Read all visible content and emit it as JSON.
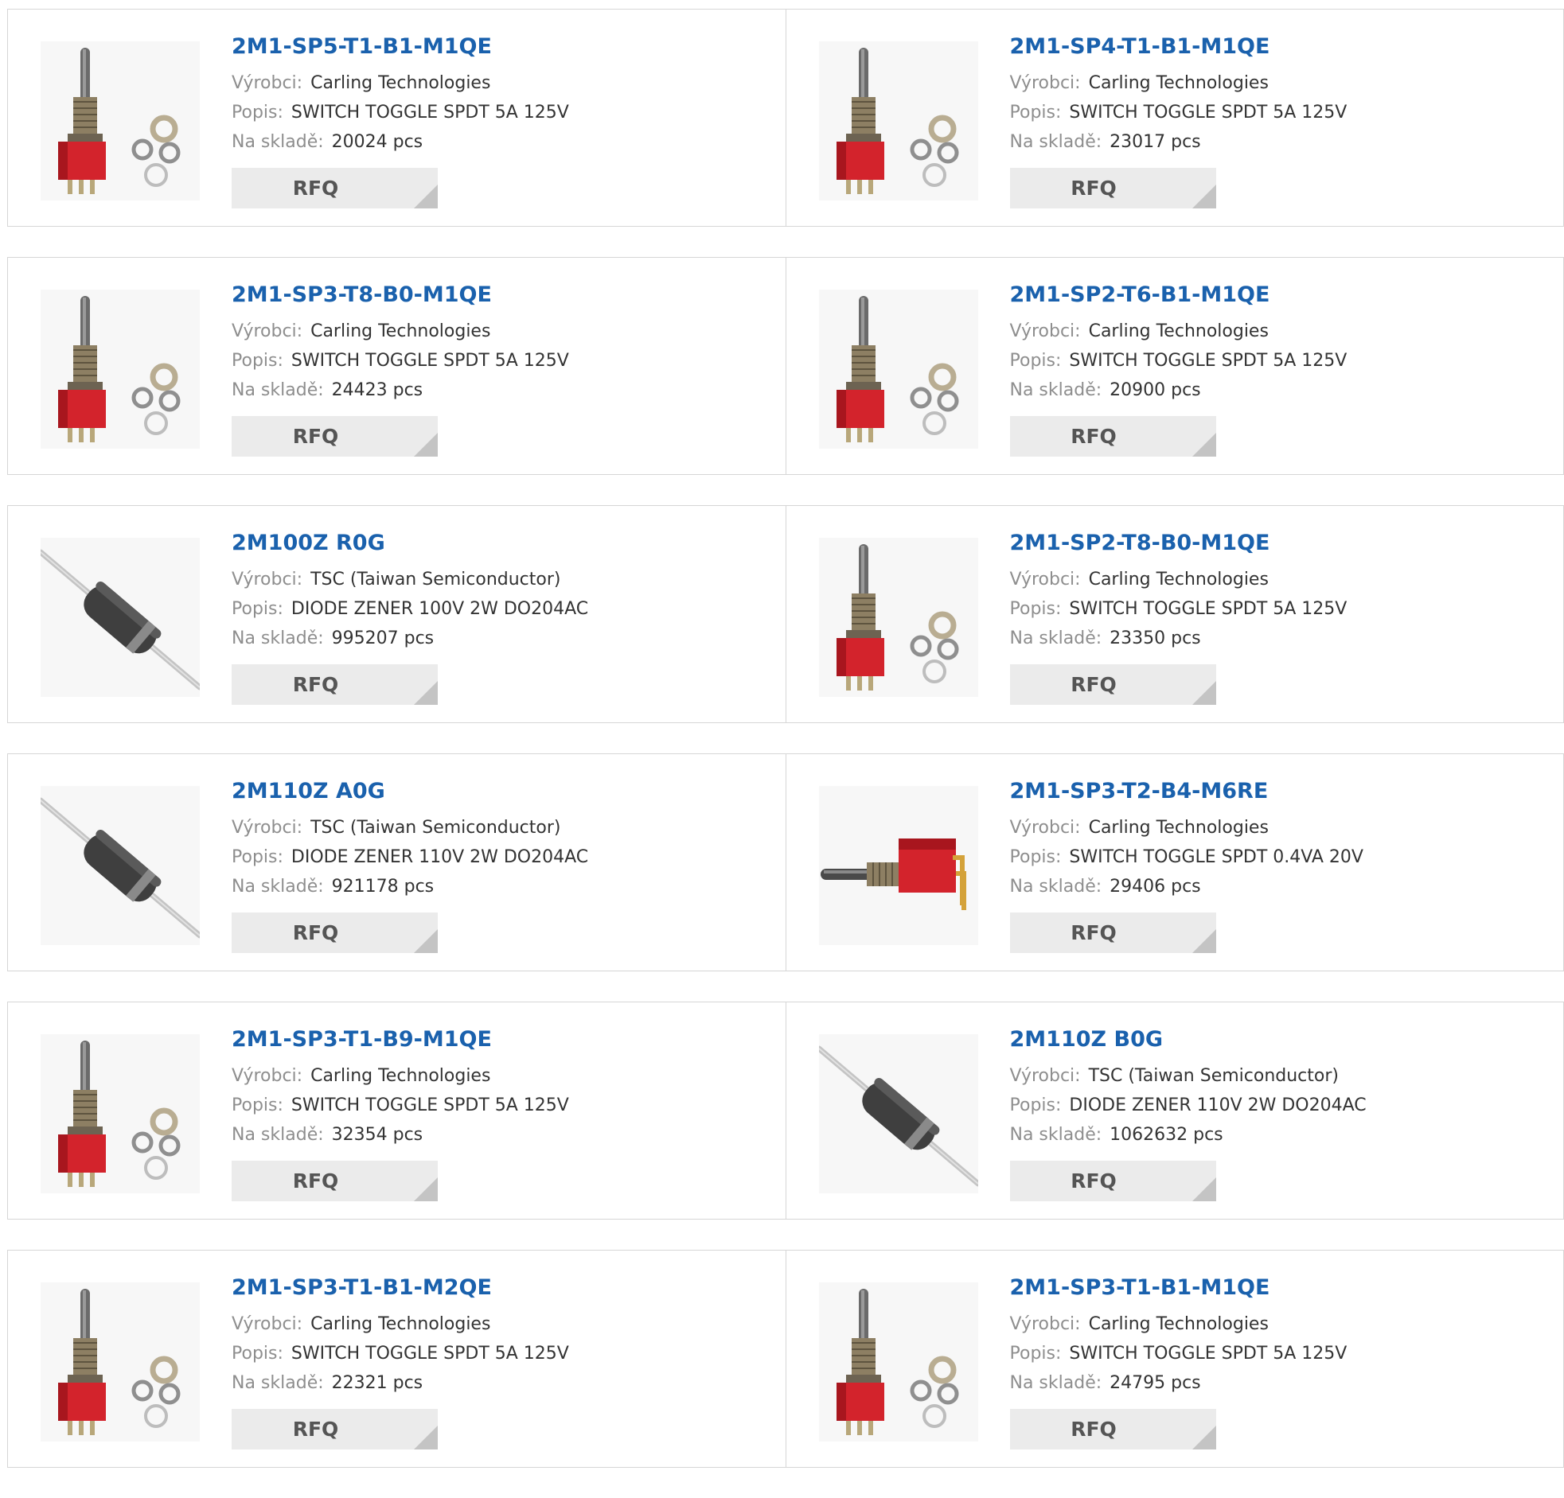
{
  "labels": {
    "manufacturer": "Výrobci:",
    "description": "Popis:",
    "stock": "Na skladě:",
    "rfq": "RFQ"
  },
  "products": [
    {
      "part": "2M1-SP5-T1-B1-M1QE",
      "manufacturer": "Carling Technologies",
      "description": "SWITCH TOGGLE SPDT 5A 125V",
      "stock": "20024 pcs",
      "image_icon": "toggle-switch-image"
    },
    {
      "part": "2M1-SP4-T1-B1-M1QE",
      "manufacturer": "Carling Technologies",
      "description": "SWITCH TOGGLE SPDT 5A 125V",
      "stock": "23017 pcs",
      "image_icon": "toggle-switch-image"
    },
    {
      "part": "2M1-SP3-T8-B0-M1QE",
      "manufacturer": "Carling Technologies",
      "description": "SWITCH TOGGLE SPDT 5A 125V",
      "stock": "24423 pcs",
      "image_icon": "toggle-switch-image"
    },
    {
      "part": "2M1-SP2-T6-B1-M1QE",
      "manufacturer": "Carling Technologies",
      "description": "SWITCH TOGGLE SPDT 5A 125V",
      "stock": "20900 pcs",
      "image_icon": "toggle-switch-image"
    },
    {
      "part": "2M100Z R0G",
      "manufacturer": "TSC (Taiwan Semiconductor)",
      "description": "DIODE ZENER 100V 2W DO204AC",
      "stock": "995207 pcs",
      "image_icon": "zener-diode-image"
    },
    {
      "part": "2M1-SP2-T8-B0-M1QE",
      "manufacturer": "Carling Technologies",
      "description": "SWITCH TOGGLE SPDT 5A 125V",
      "stock": "23350 pcs",
      "image_icon": "toggle-switch-image"
    },
    {
      "part": "2M110Z A0G",
      "manufacturer": "TSC (Taiwan Semiconductor)",
      "description": "DIODE ZENER 110V 2W DO204AC",
      "stock": "921178 pcs",
      "image_icon": "zener-diode-image"
    },
    {
      "part": "2M1-SP3-T2-B4-M6RE",
      "manufacturer": "Carling Technologies",
      "description": "SWITCH TOGGLE SPDT 0.4VA 20V",
      "stock": "29406 pcs",
      "image_icon": "right-angle-toggle-switch-image"
    },
    {
      "part": "2M1-SP3-T1-B9-M1QE",
      "manufacturer": "Carling Technologies",
      "description": "SWITCH TOGGLE SPDT 5A 125V",
      "stock": "32354 pcs",
      "image_icon": "toggle-switch-image"
    },
    {
      "part": "2M110Z B0G",
      "manufacturer": "TSC (Taiwan Semiconductor)",
      "description": "DIODE ZENER 110V 2W DO204AC",
      "stock": "1062632 pcs",
      "image_icon": "zener-diode-image"
    },
    {
      "part": "2M1-SP3-T1-B1-M2QE",
      "manufacturer": "Carling Technologies",
      "description": "SWITCH TOGGLE SPDT 5A 125V",
      "stock": "22321 pcs",
      "image_icon": "toggle-switch-image"
    },
    {
      "part": "2M1-SP3-T1-B1-M1QE",
      "manufacturer": "Carling Technologies",
      "description": "SWITCH TOGGLE SPDT 5A 125V",
      "stock": "24795 pcs",
      "image_icon": "toggle-switch-image"
    }
  ],
  "colors": {
    "link": "#1a61ad",
    "label": "#8e8e8e",
    "value": "#333333",
    "border": "#d6d6d6",
    "rfq_bg": "#ebebeb",
    "rfq_text": "#555555",
    "switch_body": "#d3232c"
  }
}
